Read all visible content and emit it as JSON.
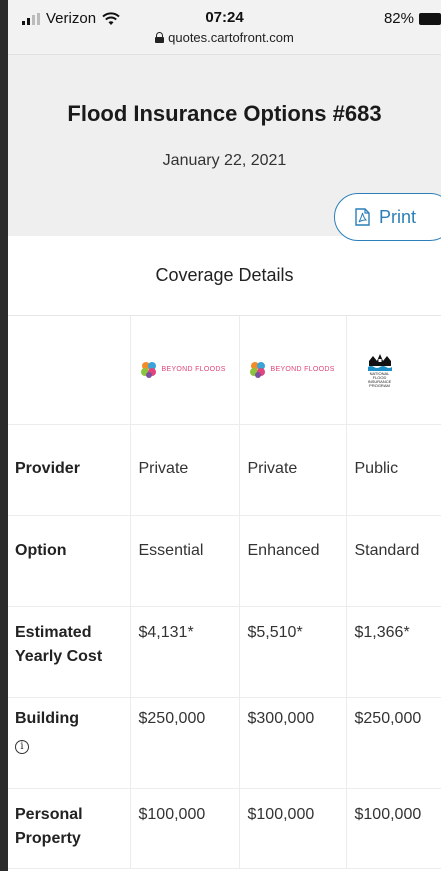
{
  "status_bar": {
    "carrier": "Verizon",
    "time": "07:24",
    "url": "quotes.cartofront.com",
    "battery": "82%"
  },
  "header": {
    "title": "Flood Insurance Options #683",
    "date": "January 22, 2021",
    "print_label": "Print"
  },
  "coverage": {
    "section_title": "Coverage Details",
    "logos": {
      "beyond_floods": "BEYOND FLOODS",
      "nfip": "NATIONAL FLOOD INSURANCE PROGRAM"
    },
    "rows": [
      {
        "label": "Provider",
        "values": [
          "Private",
          "Private",
          "Public"
        ]
      },
      {
        "label": "Option",
        "values": [
          "Essential",
          "Enhanced",
          "Standard"
        ]
      },
      {
        "label": "Estimated Yearly Cost",
        "values": [
          "$4,131*",
          "$5,510*",
          "$1,366*"
        ]
      },
      {
        "label": "Building",
        "values": [
          "$250,000",
          "$300,000",
          "$250,000"
        ]
      },
      {
        "label": "Personal Property",
        "values": [
          "$100,000",
          "$100,000",
          "$100,000"
        ]
      }
    ]
  },
  "colors": {
    "accent": "#2c7fb8",
    "header_bg": "#efefef"
  },
  "icons": [
    "signal-icon",
    "wifi-icon",
    "lock-icon",
    "battery-icon",
    "pdf-icon",
    "info-icon"
  ]
}
